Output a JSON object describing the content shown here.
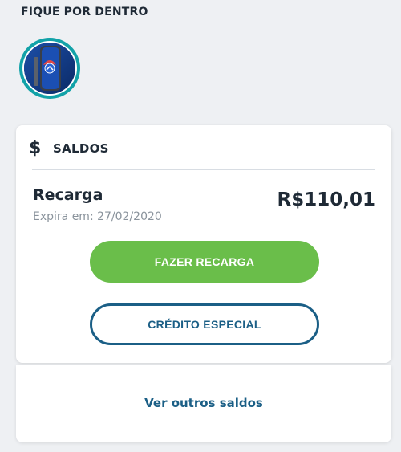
{
  "section": {
    "title": "FIQUE POR DENTRO"
  },
  "story": {
    "icon": "phone-promo-image"
  },
  "balances": {
    "icon": "dollar-icon",
    "title": "SALDOS",
    "item": {
      "label": "Recarga",
      "expiry": "Expira em: 27/02/2020",
      "amount": "R$110,01"
    },
    "recharge_button": "FAZER RECARGA",
    "special_credit_button": "CRÉDITO ESPECIAL",
    "more_link": "Ver outros saldos"
  },
  "colors": {
    "background": "#eef0f3",
    "primary_green": "#6abe4a",
    "brand_blue": "#1b5f86",
    "story_ring": "#12a2a8",
    "text_dark": "#1f2a36",
    "text_muted": "#8a939c"
  }
}
